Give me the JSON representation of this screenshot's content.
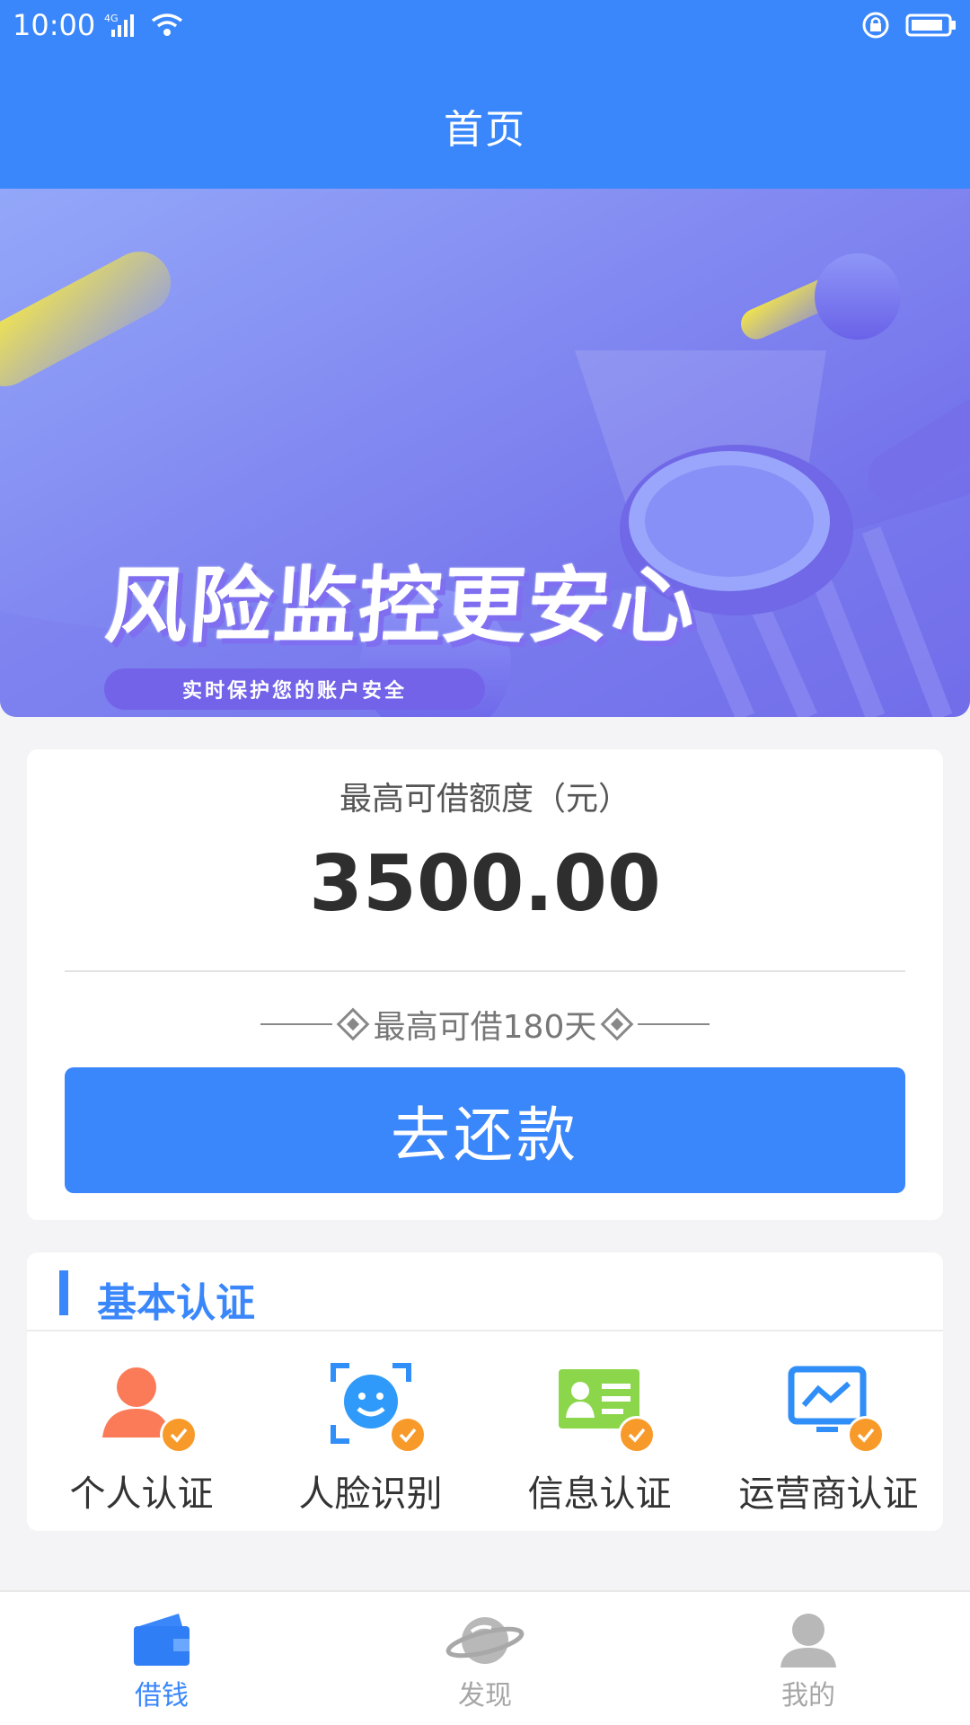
{
  "status_bar": {
    "time": "10:00",
    "network": "4G"
  },
  "header": {
    "title": "首页"
  },
  "banner": {
    "headline": "风险监控更安心",
    "tagline": "实时保护您的账户安全"
  },
  "credit": {
    "label": "最高可借额度（元）",
    "amount": "3500.00",
    "term_text": "最高可借180天",
    "button_label": "去还款"
  },
  "verification": {
    "title": "基本认证",
    "items": [
      {
        "label": "个人认证",
        "icon": "person-icon",
        "verified": true
      },
      {
        "label": "人脸识别",
        "icon": "face-scan-icon",
        "verified": true
      },
      {
        "label": "信息认证",
        "icon": "id-card-icon",
        "verified": true
      },
      {
        "label": "运营商认证",
        "icon": "monitor-chart-icon",
        "verified": true
      }
    ]
  },
  "tabbar": {
    "tabs": [
      {
        "label": "借钱",
        "icon": "wallet-icon",
        "active": true
      },
      {
        "label": "发现",
        "icon": "planet-icon",
        "active": false
      },
      {
        "label": "我的",
        "icon": "user-icon",
        "active": false
      }
    ]
  },
  "colors": {
    "primary": "#3a86fb",
    "badge": "#f89a2a",
    "banner_start": "#8da3f8",
    "banner_end": "#6c63e6"
  }
}
